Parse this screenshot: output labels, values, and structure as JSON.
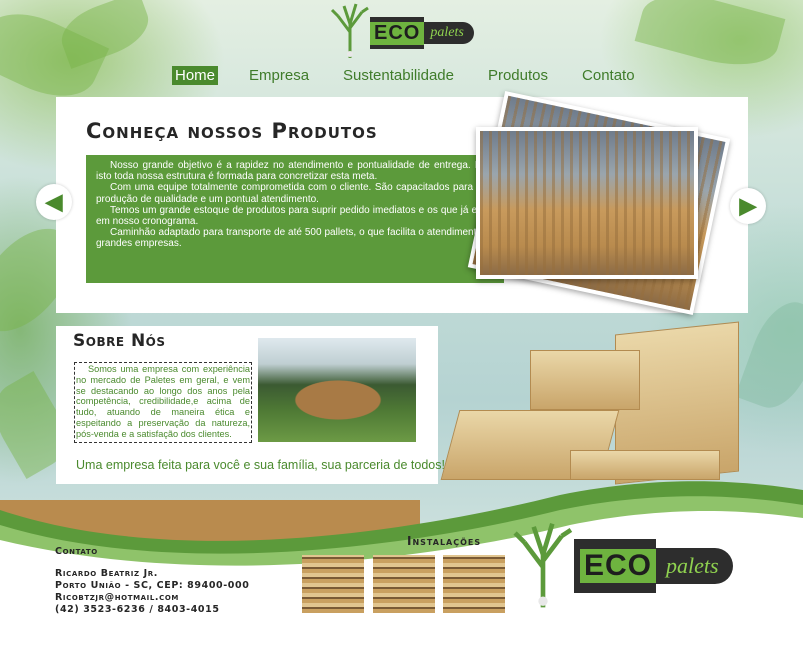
{
  "brand": {
    "eco": "ECO",
    "palets": "palets"
  },
  "nav": {
    "items": [
      {
        "label": "Home",
        "active": true
      },
      {
        "label": "Empresa",
        "active": false
      },
      {
        "label": "Sustentabilidade",
        "active": false
      },
      {
        "label": "Produtos",
        "active": false
      },
      {
        "label": "Contato",
        "active": false
      }
    ]
  },
  "products": {
    "title": "Conheça nossos Produtos",
    "paragraphs": [
      "Nosso grande objetivo é a rapidez no atendimento e pontualidade de entrega. Para isto toda nossa estrutura é formada para concretizar esta meta.",
      "Com uma equipe totalmente comprometida com o cliente. São capacitados para uma produção de qualidade e um pontual atendimento.",
      "Temos um grande estoque de produtos para suprir pedido imediatos e os que já estão em nosso cronograma.",
      "Caminhão adaptado para transporte de até 500 pallets, o que facilita o atendimento de grandes empresas."
    ]
  },
  "about": {
    "title": "Sobre Nós",
    "text": "Somos uma empresa com experiência no mercado de Paletes em geral, e vem se destacando ao longo dos anos pela competência, credibilidade,e acima de tudo, atuando de maneira ética e espeitando a preservação da natureza, pós-venda e a satisfação dos clientes.",
    "slogan": "Uma empresa feita para você e sua família, sua parceria de todos!"
  },
  "contact": {
    "heading": "Contato",
    "name": "Ricardo Beatriz Jr.",
    "address": "Porto União - SC, CEP: 89400-000",
    "email": "Ricobtzjr@hotmail.com",
    "phone": "(42) 3523-6236 / 8403-4015"
  },
  "installations": {
    "title": "Instalações"
  },
  "colors": {
    "accent": "#5c9a3b",
    "dark": "#2d2d2d",
    "text": "#262626"
  },
  "icons": {
    "prev": "arrow-left-icon",
    "next": "arrow-right-icon",
    "logo_tree": "tree-icon"
  }
}
